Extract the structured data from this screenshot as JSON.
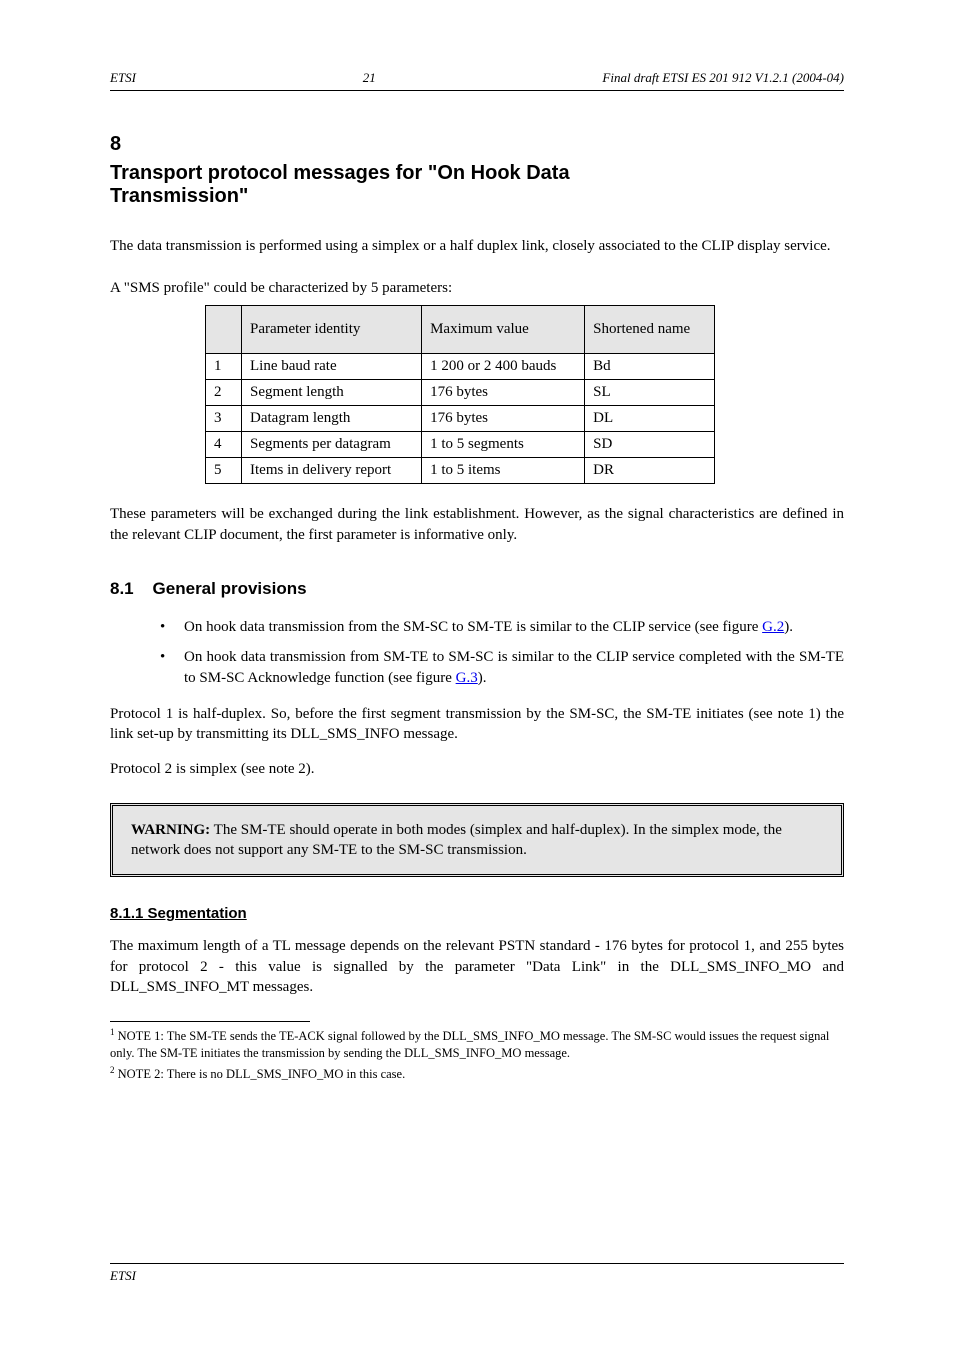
{
  "header": {
    "left": "ETSI",
    "right": "Final draft ETSI ES 201 912 V1.2.1 (2004-04)"
  },
  "page_number": "21",
  "section": {
    "number": "8",
    "title_line1": "Transport protocol messages for \"On Hook Data",
    "title_line2": "Transmission\"",
    "intro": "The data transmission is performed using a simplex or a half duplex link, closely associated to the CLIP display service."
  },
  "table": {
    "caption": "A \"SMS profile\" could be characterized by 5 parameters:",
    "headers": [
      "Parameter identity",
      "Maximum value",
      "Shortened name"
    ],
    "rows": [
      [
        "1",
        "Line baud rate",
        "1 200 or 2 400 bauds",
        "Bd"
      ],
      [
        "2",
        "Segment length",
        "176 bytes",
        "SL"
      ],
      [
        "3",
        "Datagram length",
        "176 bytes",
        "DL"
      ],
      [
        "4",
        "Segments per datagram",
        "1 to 5 segments",
        "SD"
      ],
      [
        "5",
        "Items in delivery report",
        "1 to 5 items",
        "DR"
      ]
    ]
  },
  "para_after_table": "These parameters will be exchanged during the link establishment. However, as the signal characteristics are defined in the relevant CLIP document, the first parameter is informative only.",
  "subsection": {
    "number": "8.1",
    "title": "General provisions"
  },
  "bullets": [
    {
      "prefix": "On hook data transmission from the SM-SC to SM-TE is similar to the CLIP service (see figure ",
      "link": "G.2",
      "suffix": ")."
    },
    {
      "prefix": "On hook data transmission from SM-TE to SM-SC is similar to the CLIP service completed with the SM-TE to SM-SC Acknowledge function (see figure ",
      "link": "G.3",
      "suffix": ")."
    }
  ],
  "protocol1_text": "Protocol 1 is half-duplex. So, before the first segment transmission by the SM-SC, the SM-TE initiates (see note 1) the link set-up by transmitting its DLL_SMS_INFO message.",
  "protocol2_text": "Protocol 2 is simplex (see note 2).",
  "warning": {
    "strong": "WARNING:",
    "text": " The SM-TE should operate in both modes (simplex and half-duplex). In the simplex mode, the network does not support any SM-TE to the SM-SC transmission."
  },
  "subsubsection": "8.1.1 Segmentation",
  "seg_para": "The maximum length of a TL message depends on the relevant PSTN standard - 176 bytes for protocol 1, and 255 bytes for protocol 2 - this value is signalled by the parameter \"Data Link\" in the DLL_SMS_INFO_MO and DLL_SMS_INFO_MT messages.",
  "footnotes": [
    {
      "num": "1",
      "text": "NOTE 1: The SM-TE sends the TE-ACK signal followed by the DLL_SMS_INFO_MO message. The SM-SC would issues the request signal only. The SM-TE initiates the transmission by sending the DLL_SMS_INFO_MO message."
    },
    {
      "num": "2",
      "text": "NOTE 2: There is no DLL_SMS_INFO_MO in this case."
    }
  ],
  "footer": {
    "left": "ETSI",
    "right": ""
  }
}
